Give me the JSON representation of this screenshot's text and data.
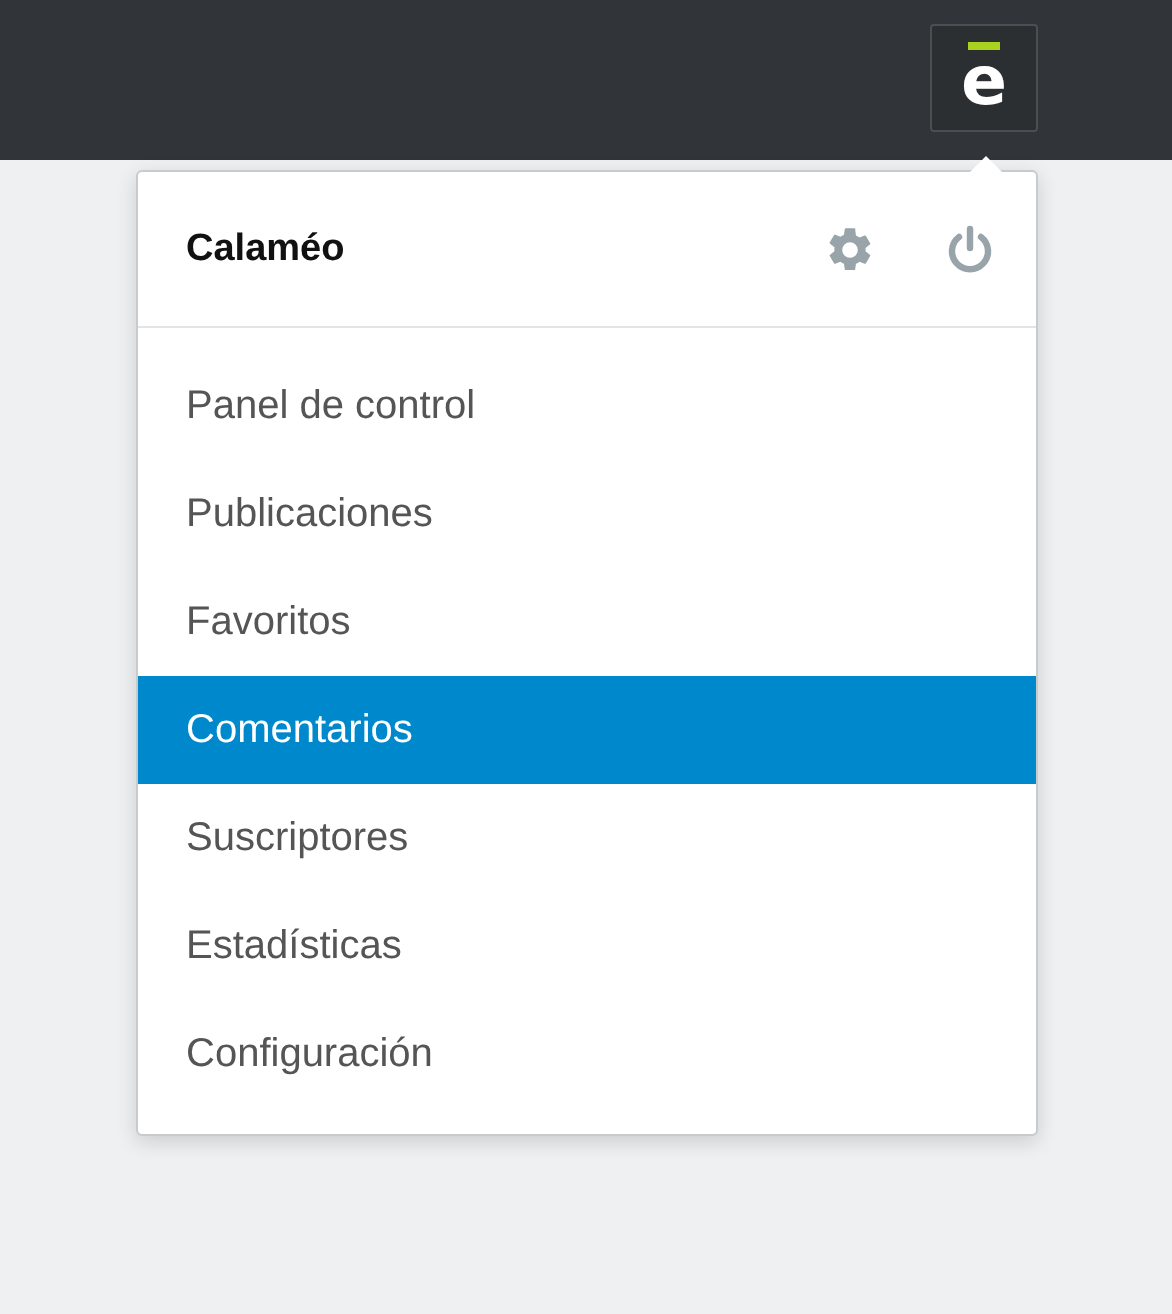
{
  "topbar": {
    "logo": "e"
  },
  "menu": {
    "title": "Calaméo",
    "items": [
      {
        "label": "Panel de control",
        "selected": false
      },
      {
        "label": "Publicaciones",
        "selected": false
      },
      {
        "label": "Favoritos",
        "selected": false
      },
      {
        "label": "Comentarios",
        "selected": true
      },
      {
        "label": "Suscriptores",
        "selected": false
      },
      {
        "label": "Estadísticas",
        "selected": false
      },
      {
        "label": "Configuración",
        "selected": false
      }
    ]
  }
}
